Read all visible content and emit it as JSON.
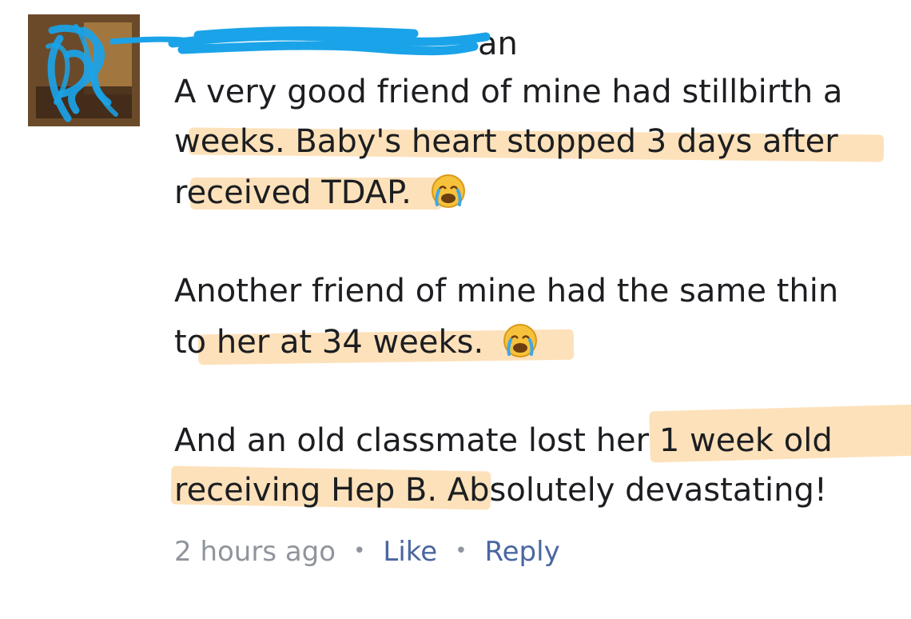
{
  "comment": {
    "author_visible_fragment": "an",
    "lines": [
      "A very good friend of mine had stillbirth a",
      "weeks. Baby's heart stopped 3 days after",
      "received TDAP.",
      "Another friend of mine had the same thin",
      "to her at 34 weeks.",
      "And an old classmate lost her 1 week old",
      "receiving Hep B. Absolutely devastating!"
    ],
    "emoji": [
      "crying-face-emoji",
      "crying-face-emoji"
    ]
  },
  "meta": {
    "timestamp": "2 hours ago",
    "separator": "•",
    "like_label": "Like",
    "reply_label": "Reply"
  },
  "colors": {
    "highlight": "#fcc882",
    "redaction_scribble": "#1aa3e8",
    "link": "#4b67a1",
    "muted": "#90949c",
    "text": "#1c1e21"
  }
}
